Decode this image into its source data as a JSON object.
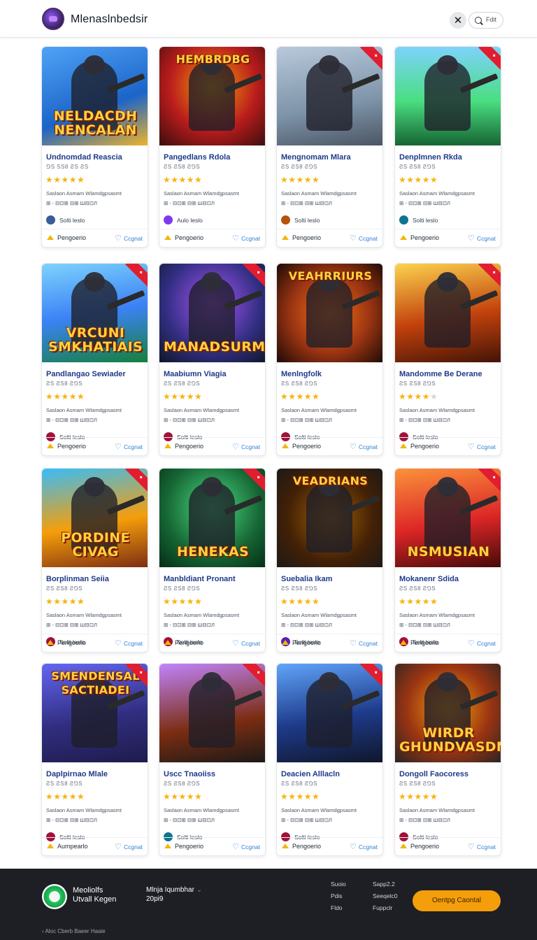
{
  "header": {
    "app_title": "Mlenaslnbedsir",
    "search_label": "Fdit"
  },
  "colors": {
    "accent": "#2f7fd6",
    "star": "#f5b50a",
    "ribbon": "#e11d2f",
    "cta": "#f59e0b",
    "footer_bg": "#1d1f24"
  },
  "cards": [
    {
      "title": "Undnomdad Reascia",
      "meta": "⅁S SS8 ƧS ƧS",
      "rating": 5,
      "desc_1": "Saslaon Asmam Wlamdgpsasmt",
      "desc_2": "⊞ - ⊟⊡⊞ ⊟⊞ Ш⊟⊡Л",
      "author": "Solti leslo",
      "foot_label": "Pengoerio",
      "foot_action": "Ccgnat",
      "thumb_text": "NELDACDH NENCALAN",
      "bg": "linear-gradient(160deg,#4fa3f7,#1c64c8 60%,#f0b429)",
      "avatar": "#3b5b9a",
      "ribbon": false
    },
    {
      "title": "Pangedlans Rdola",
      "meta": "ƧS ƧS8 Ƨ⅁S",
      "rating": 5,
      "desc_1": "Saslaon Asmam Wlamdgpsasmt",
      "desc_2": "⊞ - ⊟⊡⊞ ⊟⊞ Ш⊟⊡Л",
      "author": "Aulo leslo",
      "foot_label": "Pengoerio",
      "foot_action": "Ccgnat",
      "thumb_text": "HEMBRDBG",
      "bg": "radial-gradient(circle at 50% 40%,#f59e0b,#b91c1c 55%,#3b0d0d)",
      "avatar": "#7c3aed",
      "ribbon": false,
      "logo_top": true
    },
    {
      "title": "Mengnomam Mlara",
      "meta": "ƧS ƧS8 Ƨ⅁S",
      "rating": 4.5,
      "desc_1": "Saslaon Asmam Wlamdgpsasmt",
      "desc_2": "⊞ - ⊟⊡⊞ ⊟⊞ Ш⊟⊡Л",
      "author": "Solti leslo",
      "foot_label": "Pengoerio",
      "foot_action": "Ccgnat",
      "thumb_text": "",
      "bg": "linear-gradient(170deg,#b8c9db,#7d93a8 60%,#4b5563)",
      "avatar": "#b45309",
      "ribbon": true
    },
    {
      "title": "Denplmnen Rkda",
      "meta": "ƧS ƧS8 Ƨ⅁S",
      "rating": 4.5,
      "desc_1": "Saslaon Asmam Wlamdgpsasmt",
      "desc_2": "⊞ - ⊟⊡⊞ ⊟⊞ Ш⊟⊡Л",
      "author": "Solti leslo",
      "foot_label": "Pengoerio",
      "foot_action": "Ccgnat",
      "thumb_text": "",
      "bg": "linear-gradient(180deg,#7dd3fc,#4ade80 55%,#166534)",
      "avatar": "#0e7490",
      "ribbon": true
    },
    {
      "title": "Pandlangao Sewiader",
      "meta": "ƧS ƧS8 Ƨ⅁S",
      "rating": 4.5,
      "desc_1": "Saslaon Asmam Wlamdgpsasmt",
      "desc_2": "⊞ - ⊟⊡⊞ ⊟⊞ Ш⊟⊡Л",
      "author": "Solti leslo",
      "foot_label": "Pengoerio",
      "foot_action": "Ccgnat",
      "thumb_text": "VRCUNI SMKHATIAIS",
      "bg": "linear-gradient(170deg,#7dd3fc,#3b82f6 50%,#15803d)",
      "avatar": "#9f1239",
      "ribbon": true
    },
    {
      "title": "Maabiumn Viagia",
      "meta": "ƧS ƧS8 Ƨ⅁S",
      "rating": 5,
      "desc_1": "Saslaon Asmam Wlamdgpsasmt",
      "desc_2": "⊞ - ⊟⊡⊞ ⊟⊞ Ш⊟⊡Л",
      "author": "Solti leslo",
      "foot_label": "Pengoerio",
      "foot_action": "Ccgnat",
      "thumb_text": "MANADSURM",
      "bg": "radial-gradient(circle at 50% 40%,#a855f7,#312e81 60%,#0f172a)",
      "avatar": "#9f1239",
      "ribbon": true
    },
    {
      "title": "Menlngfolk",
      "meta": "ƧS ƧS8 Ƨ⅁S",
      "rating": 5,
      "desc_1": "Saslaon Asmam Wlamdgpsasmt",
      "desc_2": "⊞ - ⊟⊡⊞ ⊟⊞ Ш⊟⊡Л",
      "author": "Solti leslo",
      "foot_label": "Pengoerio",
      "foot_action": "Ccgnat",
      "thumb_text": "VEAHRRIURS",
      "bg": "radial-gradient(circle at 50% 50%,#f97316,#9a3412 55%,#1c0a05)",
      "avatar": "#9f1239",
      "ribbon": false,
      "logo_top": true
    },
    {
      "title": "Mandomme Be Derane",
      "meta": "ƧS ƧS8 Ƨ⅁S",
      "rating": 4,
      "desc_1": "Saslaon Asmam Wlamdgpsasmt",
      "desc_2": "⊞ - ⊟⊡⊞ ⊟⊞ Ш⊟⊡Л",
      "author": "Solti leslo",
      "foot_label": "Pengoerio",
      "foot_action": "Ccgnat",
      "thumb_text": "",
      "bg": "linear-gradient(170deg,#fcd34d,#c2410c 55%,#431407)",
      "avatar": "#9f1239",
      "ribbon": true
    },
    {
      "title": "Borplinman Seiia",
      "meta": "ƧS ƧS8 Ƨ⅁S",
      "rating": 4.5,
      "desc_1": "Saslaon Asmam Wlamdgpsasmt",
      "desc_2": "⊞ - ⊟⊡⊞ ⊟⊞ Ш⊟⊡Л",
      "author": "Solti leslo",
      "foot_label": "Pengoerio",
      "foot_action": "Ccgnat",
      "thumb_text": "PORDINE CIVAG",
      "bg": "linear-gradient(170deg,#38bdf8,#f59e0b 55%,#7c2d12)",
      "avatar": "#9f1239",
      "ribbon": true
    },
    {
      "title": "Manbldiant Pronant",
      "meta": "ƧS ƧS8 Ƨ⅁S",
      "rating": 5,
      "desc_1": "Saslaon Asmam Wlamdgpsasmt",
      "desc_2": "⊞ - ⊟⊡⊞ ⊟⊞ Ш⊟⊡Л",
      "author": "Solti leslo",
      "foot_label": "Pengoerio",
      "foot_action": "Ccgnat",
      "thumb_text": "HENEKAS",
      "bg": "radial-gradient(circle at 50% 40%,#4ade80,#166534 60%,#052e16)",
      "avatar": "#9f1239",
      "ribbon": true
    },
    {
      "title": "Suebalia Ikam",
      "meta": "ƧS ƧS8 Ƨ⅁S",
      "rating": 5,
      "desc_1": "Saslaon Asmam Wlamdgpsasmt",
      "desc_2": "⊞ - ⊟⊡⊞ ⊟⊞ Ш⊟⊡Л",
      "author": "Solti leslo",
      "foot_label": "Pengoerio",
      "foot_action": "Ccgnat",
      "thumb_text": "VEADRIANS",
      "bg": "radial-gradient(circle at 50% 50%,#a16207,#422006 60%,#1c1917)",
      "avatar": "#5b21b6",
      "ribbon": false,
      "logo_top": true
    },
    {
      "title": "Mokanenr Sdida",
      "meta": "ƧS ƧS8 Ƨ⅁S",
      "rating": 4.5,
      "desc_1": "Saslaon Asmam Wlamdgpsasmt",
      "desc_2": "⊞ - ⊟⊡⊞ ⊟⊞ Ш⊟⊡Л",
      "author": "Solti leslo",
      "foot_label": "Pengoerio",
      "foot_action": "Ccgnat",
      "thumb_text": "NSMUSIAN",
      "bg": "linear-gradient(170deg,#fb923c,#dc2626 55%,#450a0a)",
      "avatar": "#9f1239",
      "ribbon": true
    },
    {
      "title": "Daplpirnao Mlale",
      "meta": "ƧS ƧS8 Ƨ⅁S",
      "rating": 4.5,
      "desc_1": "Saslaon Asmam Wlamdgpsasmt",
      "desc_2": "⊞ - ⊟⊡⊞ ⊟⊞ Ш⊟⊡Л",
      "author": "Solti leslo",
      "foot_label": "Aumpearlo",
      "foot_action": "Ccgnat",
      "thumb_text": "SMENDENSAL SACTIADEI",
      "bg": "linear-gradient(170deg,#6366f1,#312e81 55%,#1e1b4b)",
      "avatar": "#9f1239",
      "ribbon": true,
      "logo_top": true
    },
    {
      "title": "Uscc Tnaoiiss",
      "meta": "ƧS ƧS8 Ƨ⅁S",
      "rating": 5,
      "desc_1": "Saslaon Asmam Wlamdgpsasmt",
      "desc_2": "⊞ - ⊟⊡⊞ ⊟⊞ Ш⊟⊡Л",
      "author": "Solti leslo",
      "foot_label": "Pengoerio",
      "foot_action": "Ccgnat",
      "thumb_text": "",
      "bg": "linear-gradient(170deg,#c084fc,#7c2d12 60%,#1c1917)",
      "avatar": "#0e7490",
      "ribbon": true
    },
    {
      "title": "Deacien Alllacln",
      "meta": "ƧS ƧS8 Ƨ⅁S",
      "rating": 5,
      "desc_1": "Saslaon Asmam Wlamdgpsasmt",
      "desc_2": "⊞ - ⊟⊡⊞ ⊟⊞ Ш⊟⊡Л",
      "author": "Solti leslo",
      "foot_label": "Pengoerio",
      "foot_action": "Ccgnat",
      "thumb_text": "",
      "bg": "linear-gradient(170deg,#60a5fa,#1e3a8a 55%,#0f172a)",
      "avatar": "#9f1239",
      "ribbon": true
    },
    {
      "title": "Dongoll Faocoress",
      "meta": "ƧS ƧS8 Ƨ⅁S",
      "rating": 4.5,
      "desc_1": "Saslaon Asmam Wlamdgpsasmt",
      "desc_2": "⊞ - ⊟⊡⊞ ⊟⊞ Ш⊟⊡Л",
      "author": "Solti leslo",
      "foot_label": "Pengoerio",
      "foot_action": "Ccgnat",
      "thumb_text": "WIRDR GHUNDVASDN",
      "bg": "radial-gradient(circle at 50% 45%,#f59e0b,#9a3412 55%,#292524)",
      "avatar": "#9f1239",
      "ribbon": false
    }
  ],
  "footer": {
    "brand_1": "Meoliolfs",
    "brand_2": "Utvall Kegen",
    "mid_1": "Mlnja Iqumbhar",
    "mid_2": "20pi9",
    "links": [
      "Suoio",
      "Pdis",
      "Fldo",
      "Sapp2.2",
      "Seeqelc0",
      "Fuppclr"
    ],
    "cta_label": "Oentpg Caontal",
    "copyright": "‹ Aloc Cberb Baeer Haaie"
  }
}
